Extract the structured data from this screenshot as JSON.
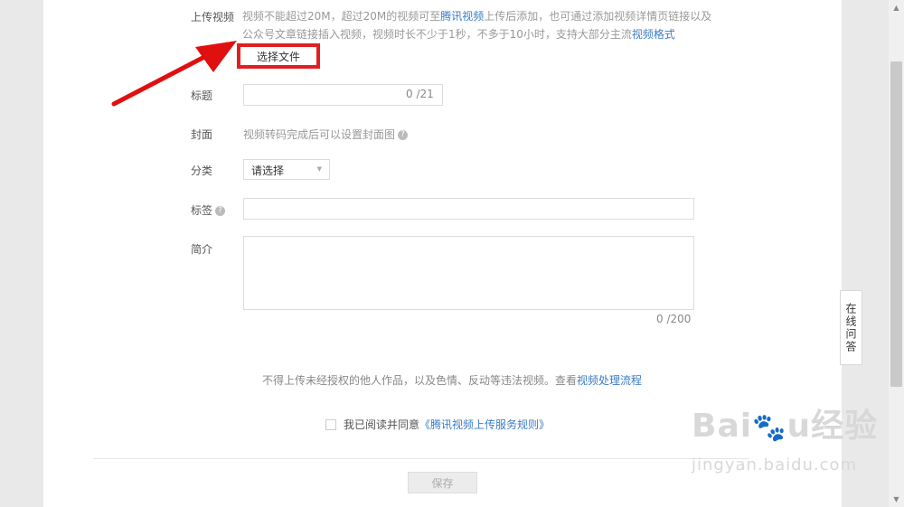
{
  "form": {
    "upload_label": "上传视频",
    "upload_help": {
      "part1": "视频不能超过20M，超过20M的视频可至",
      "link1": "腾讯视频",
      "part2": "上传后添加，也可通过添加视频详情页链接以及公众号文章链接插入视频，视频时长不少于1秒，不多于10小时，支持大部分主流",
      "link2": "视频格式"
    },
    "choose_file_button": "选择文件",
    "title_label": "标题",
    "title_value": "",
    "title_counter": "0 /21",
    "cover_label": "封面",
    "cover_hint": "视频转码完成后可以设置封面图",
    "category_label": "分类",
    "category_selected": "请选择",
    "tags_label": "标签",
    "tags_value": "",
    "intro_label": "简介",
    "intro_value": "",
    "intro_counter": "0 /200"
  },
  "notice": {
    "text": "不得上传未经授权的他人作品，以及色情、反动等违法视频。查看",
    "link": "视频处理流程"
  },
  "agreement": {
    "checked": false,
    "text": "我已阅读并同意",
    "link": "《腾讯视频上传服务规则》"
  },
  "save_button": "保存",
  "online_qa": "在线问答",
  "icons": {
    "help": "question-circle-icon",
    "dropdown": "caret-down-icon",
    "annotation": "red-arrow-icon"
  },
  "watermark": {
    "logo": "Baidu经验",
    "url": "jingyan.baidu.com"
  },
  "colors": {
    "link": "#3b7cc5",
    "highlight": "#e02020",
    "arrow": "#e01010"
  }
}
